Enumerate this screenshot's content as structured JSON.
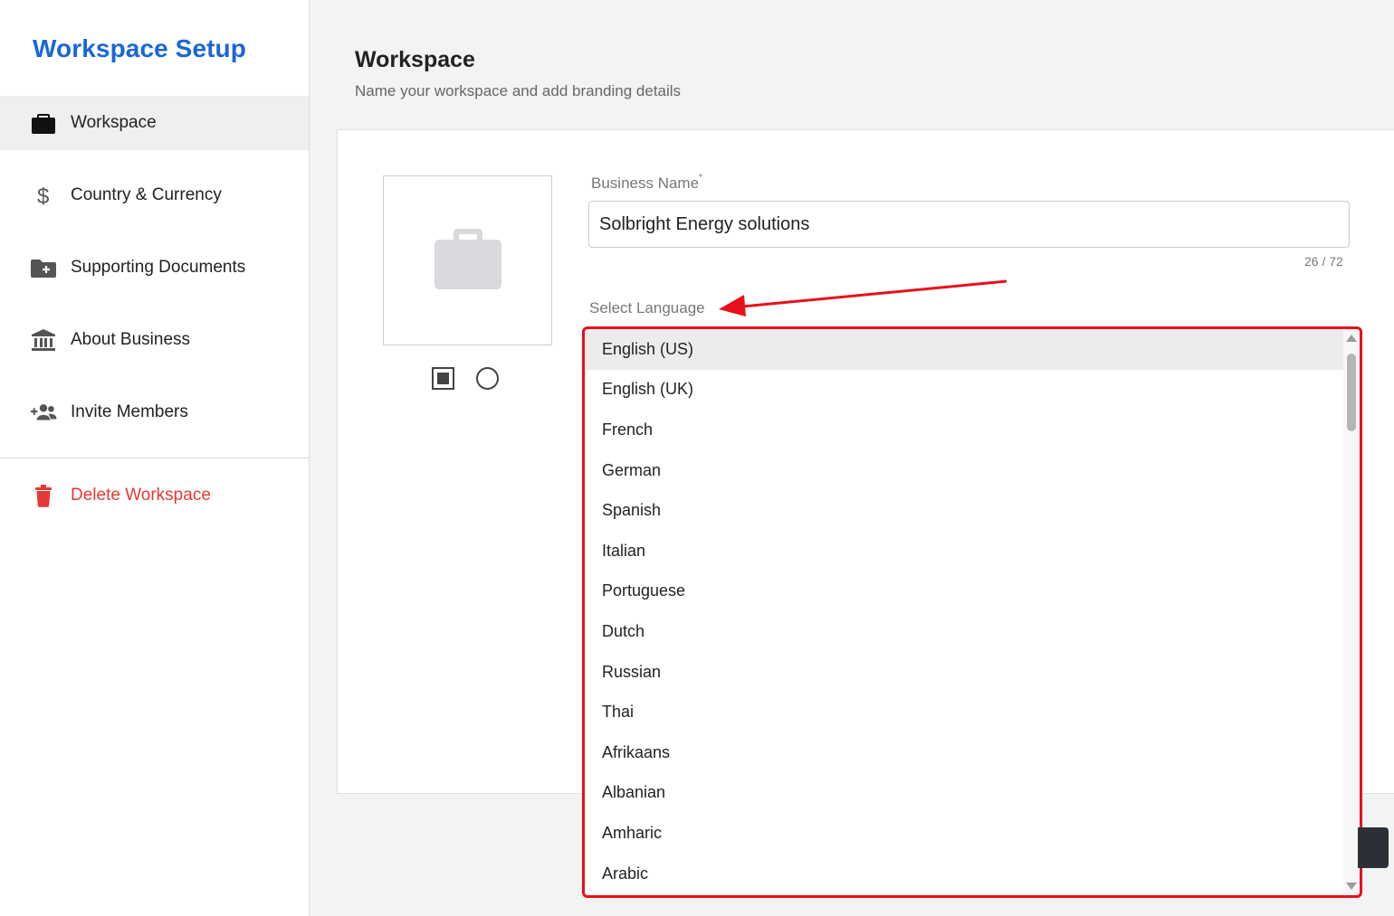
{
  "sidebar": {
    "title": "Workspace Setup",
    "items": [
      {
        "label": "Workspace",
        "icon": "briefcase-icon",
        "active": true
      },
      {
        "label": "Country & Currency",
        "icon": "dollar-icon",
        "active": false
      },
      {
        "label": "Supporting Documents",
        "icon": "folder-add-icon",
        "active": false
      },
      {
        "label": "About Business",
        "icon": "bank-icon",
        "active": false
      },
      {
        "label": "Invite Members",
        "icon": "add-people-icon",
        "active": false
      }
    ],
    "danger_item": {
      "label": "Delete Workspace",
      "icon": "trash-icon"
    }
  },
  "main": {
    "title": "Workspace",
    "subtitle": "Name your workspace and add branding details",
    "business_name": {
      "label": "Business Name",
      "required_mark": "*",
      "value": "Solbright Energy solutions",
      "counter": "26 / 72"
    },
    "language": {
      "label": "Select Language",
      "selected": "English (US)",
      "options": [
        "English (US)",
        "English (UK)",
        "French",
        "German",
        "Spanish",
        "Italian",
        "Portuguese",
        "Dutch",
        "Russian",
        "Thai",
        "Afrikaans",
        "Albanian",
        "Amharic",
        "Arabic"
      ]
    },
    "logo": {
      "placeholder_icon": "briefcase-icon",
      "shape_options": [
        "square-shape-icon",
        "circle-shape-icon"
      ]
    }
  },
  "colors": {
    "brand": "#1a66d8",
    "danger": "#e53935",
    "annotation": "#e8101a"
  }
}
